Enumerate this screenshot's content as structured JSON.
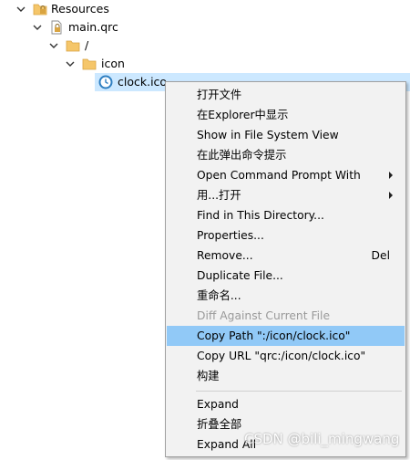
{
  "tree": {
    "items": [
      {
        "label": "Resources"
      },
      {
        "label": "main.qrc"
      },
      {
        "label": "/"
      },
      {
        "label": "icon"
      },
      {
        "label": "clock.ico"
      }
    ]
  },
  "context_menu": {
    "items": [
      {
        "label": "打开文件"
      },
      {
        "label": "在Explorer中显示"
      },
      {
        "label": "Show in File System View"
      },
      {
        "label": "在此弹出命令提示"
      },
      {
        "label": "Open Command Prompt With"
      },
      {
        "label": "用...打开"
      },
      {
        "label": "Find in This Directory..."
      },
      {
        "label": "Properties..."
      },
      {
        "label": "Remove...",
        "shortcut": "Del"
      },
      {
        "label": "Duplicate File..."
      },
      {
        "label": "重命名..."
      },
      {
        "label": "Diff Against Current File"
      },
      {
        "label": "Copy Path \":/icon/clock.ico\""
      },
      {
        "label": "Copy URL \"qrc:/icon/clock.ico\""
      },
      {
        "label": "构建"
      },
      {
        "label": "Expand"
      },
      {
        "label": "折叠全部"
      },
      {
        "label": "Expand All"
      }
    ]
  },
  "watermark": "CSDN @bili_mingwang",
  "colors": {
    "selection": "#cce8ff",
    "menu_highlight": "#91c9f7",
    "menu_background": "#f2f2f2",
    "folder": "#f5c66a",
    "disabled_text": "#9a9a9a"
  },
  "icons": {
    "tree_resources": "resource-folder-lock-icon",
    "tree_main_qrc": "qrc-file-lock-icon",
    "tree_root": "folder-icon",
    "tree_icon": "folder-icon",
    "tree_clock": "clock-icon"
  }
}
